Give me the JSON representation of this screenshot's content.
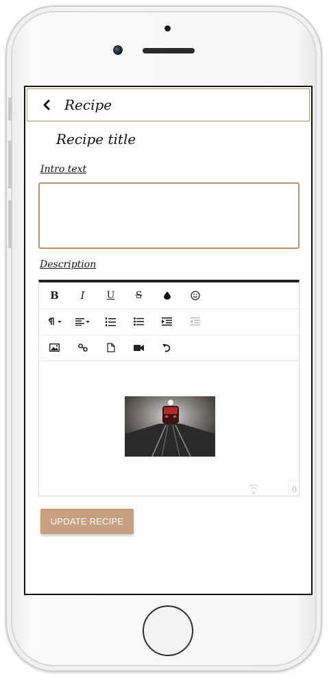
{
  "header": {
    "back_icon": "chevron-left-icon",
    "title": "Recipe"
  },
  "form": {
    "recipe_title": "Recipe title",
    "intro_label": "Intro text",
    "intro_value": "",
    "description_label": "Description"
  },
  "editor": {
    "toolbar_row1": [
      "bold-icon",
      "italic-icon",
      "underline-icon",
      "strikethrough-icon",
      "color-drop-icon",
      "emoji-icon"
    ],
    "toolbar_row2": [
      "paragraph-format-icon",
      "align-icon",
      "ordered-list-icon",
      "unordered-list-icon",
      "indent-icon",
      "outdent-icon"
    ],
    "toolbar_row3": [
      "insert-image-icon",
      "insert-link-icon",
      "insert-file-icon",
      "insert-video-icon",
      "undo-icon"
    ],
    "bold_label": "B",
    "italic_label": "I",
    "underline_label": "U",
    "strike_label": "S",
    "char_count": "0",
    "content_image": "tunnel-train-image"
  },
  "actions": {
    "update_label": "UPDATE RECIPE"
  },
  "colors": {
    "accent": "#c9a07f",
    "border_tan": "#b8926b",
    "editor_top": "#222222"
  }
}
